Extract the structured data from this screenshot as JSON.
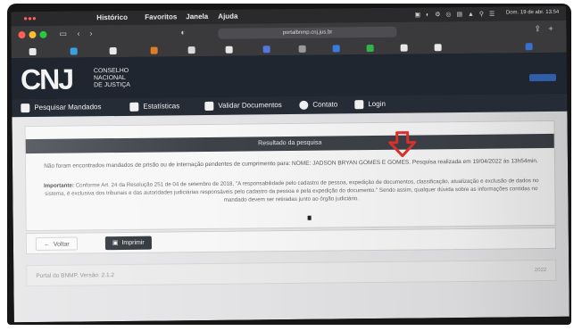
{
  "menubar": {
    "items": [
      "Histórico",
      "Favoritos",
      "Janela",
      "Ajuda"
    ],
    "clock": "Dom. 19 de abr. 13:54"
  },
  "browser": {
    "address": "portalbnmp.cnj.jus.br"
  },
  "site": {
    "logo_mark": "CNJ",
    "logo_text": [
      "CONSELHO",
      "NACIONAL",
      "DE JUSTIÇA"
    ],
    "nav": [
      {
        "label": "Pesquisar Mandados",
        "icon": "people-icon"
      },
      {
        "label": "Estatísticas",
        "icon": "chart-icon"
      },
      {
        "label": "Validar Documentos",
        "icon": "document-icon"
      },
      {
        "label": "Contato",
        "icon": "question-icon"
      },
      {
        "label": "Login",
        "icon": "lock-icon"
      }
    ]
  },
  "result": {
    "title": "Resultado da pesquisa",
    "message": "Não foram encontrados mandados de prisão ou de internação pendentes de cumprimento para: NOME: JADSON BRYAN GOMES E GOMES. Pesquisa realizada em 19/04/2022 às 13h54min.",
    "important_label": "Importante:",
    "important_text": "Conforme Art. 24 da Resolução 251 de 04 de setembro de 2018, \"A responsabilidade pelo cadastro de pessoa, expedição de documentos, classificação, atualização e exclusão de dados no sistema, é exclusiva dos tribunais e das autoridades judiciárias responsáveis pelo cadastro da pessoa e pela expedição do documento.\" Sendo assim, qualquer dúvida sobre as informações contidas no mandado devem ser retiradas junto ao órgão judiciário."
  },
  "actions": {
    "back_label": "Voltar",
    "print_label": "Imprimir"
  },
  "footer": {
    "text": "Portal do BNMP. Versão: 2.1.2",
    "year": "2022"
  },
  "colors": {
    "annotation_arrow": "#e0332c",
    "header_bg": "#1f2630",
    "panel_title_bg": "#3d4148"
  }
}
